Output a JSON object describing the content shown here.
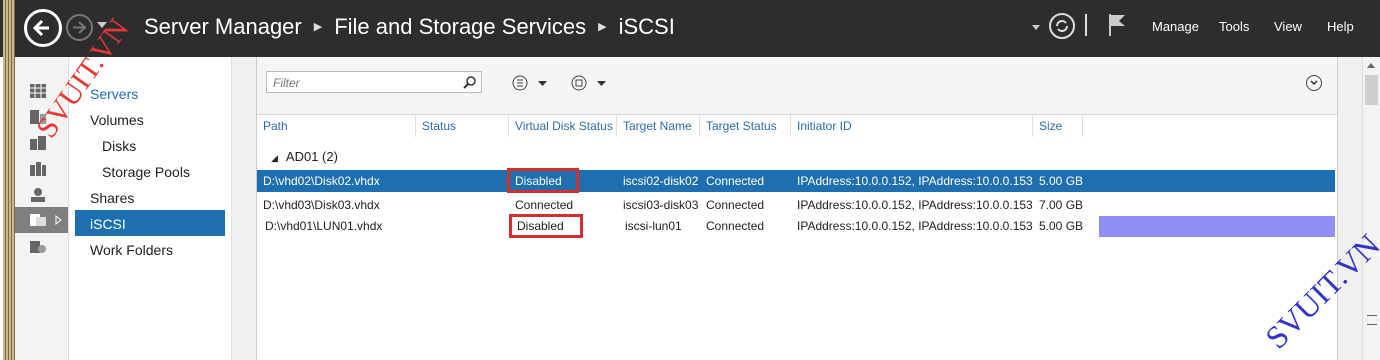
{
  "titlebar": {
    "breadcrumb": [
      "Server Manager",
      "File and Storage Services",
      "iSCSI"
    ],
    "menu": [
      "Manage",
      "Tools",
      "View",
      "Help"
    ]
  },
  "nav": {
    "items": [
      "Servers",
      "Volumes",
      "Disks",
      "Storage Pools",
      "Shares",
      "iSCSI",
      "Work Folders"
    ],
    "selected": "iSCSI"
  },
  "toolbar": {
    "filter_placeholder": "Filter"
  },
  "table": {
    "columns": [
      "Path",
      "Status",
      "Virtual Disk Status",
      "Target Name",
      "Target Status",
      "Initiator ID",
      "Size"
    ],
    "group": "AD01 (2)",
    "rows": [
      {
        "path": "D:\\vhd02\\Disk02.vhdx",
        "status": "",
        "vds": "Disabled",
        "target": "iscsi02-disk02",
        "tstatus": "Connected",
        "initiator": "IPAddress:10.0.0.152, IPAddress:10.0.0.153",
        "size": "5.00 GB"
      },
      {
        "path": "D:\\vhd03\\Disk03.vhdx",
        "status": "",
        "vds": "Connected",
        "target": "iscsi03-disk03",
        "tstatus": "Connected",
        "initiator": "IPAddress:10.0.0.152, IPAddress:10.0.0.153",
        "size": "7.00 GB"
      },
      {
        "path": "D:\\vhd01\\LUN01.vhdx",
        "status": "",
        "vds": "Disabled",
        "target": "iscsi-lun01",
        "tstatus": "Connected",
        "initiator": "IPAddress:10.0.0.152, IPAddress:10.0.0.153",
        "size": "5.00 GB"
      }
    ]
  },
  "watermark": "SVUIT.VN"
}
